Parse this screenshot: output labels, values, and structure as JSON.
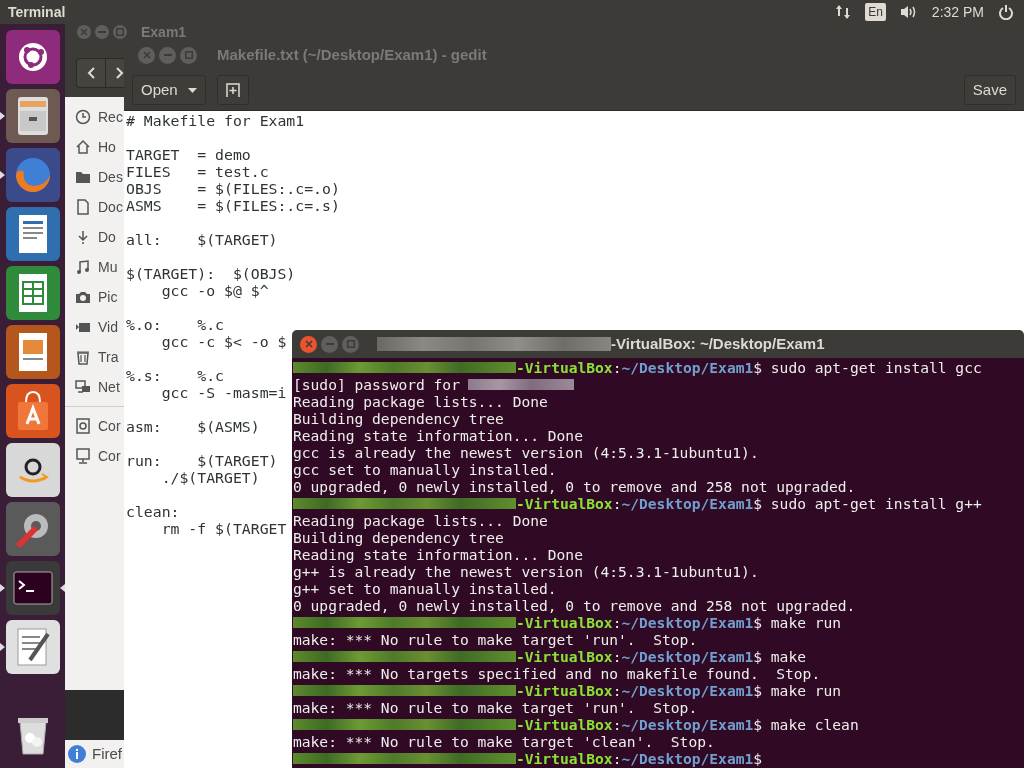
{
  "top_bar": {
    "app_title": "Terminal",
    "keyboard_layout": "En",
    "clock": "2:32 PM"
  },
  "launcher": [
    {
      "kind": "dash",
      "running": false,
      "focused": false
    },
    {
      "kind": "files",
      "running": true,
      "focused": false
    },
    {
      "kind": "browser",
      "running": true,
      "focused": false
    },
    {
      "kind": "writer",
      "running": false,
      "focused": false
    },
    {
      "kind": "calc",
      "running": false,
      "focused": false
    },
    {
      "kind": "impress",
      "running": false,
      "focused": false
    },
    {
      "kind": "store",
      "running": false,
      "focused": false
    },
    {
      "kind": "shop",
      "running": false,
      "focused": false
    },
    {
      "kind": "settings",
      "running": false,
      "focused": false
    },
    {
      "kind": "terminal",
      "running": true,
      "focused": true
    },
    {
      "kind": "editor",
      "running": true,
      "focused": false
    },
    {
      "kind": "trash",
      "running": false,
      "focused": false
    }
  ],
  "files_window": {
    "title": "Exam1",
    "sidebar": [
      {
        "kind": "clock",
        "label": "Rec"
      },
      {
        "kind": "home",
        "label": "Ho"
      },
      {
        "kind": "folder",
        "label": "Des"
      },
      {
        "kind": "document",
        "label": "Doc"
      },
      {
        "kind": "download",
        "label": "Do"
      },
      {
        "kind": "music",
        "label": "Mu"
      },
      {
        "kind": "camera",
        "label": "Pic"
      },
      {
        "kind": "video",
        "label": "Vid"
      },
      {
        "kind": "trash",
        "label": "Tra"
      },
      {
        "kind": "network",
        "label": "Net"
      },
      {
        "kind": "server",
        "label": "Cor",
        "separator_before": true
      },
      {
        "kind": "computer",
        "label": "Cor"
      }
    ],
    "status": "Firef"
  },
  "gedit": {
    "title": "Makefile.txt (~/Desktop/Exam1) - gedit",
    "open_button": "Open",
    "save_button": "Save",
    "lines": [
      {
        "kind": "code",
        "text": "# Makefile for Exam1"
      },
      {
        "kind": "blank"
      },
      {
        "kind": "code",
        "text": "TARGET  = demo"
      },
      {
        "kind": "code",
        "text": "FILES   = test.c"
      },
      {
        "kind": "code",
        "text": "OBJS    = $(FILES:.c=.o)"
      },
      {
        "kind": "code",
        "text": "ASMS    = $(FILES:.c=.s)"
      },
      {
        "kind": "blank"
      },
      {
        "kind": "code",
        "text": "all:    $(TARGET)"
      },
      {
        "kind": "blank"
      },
      {
        "kind": "code",
        "text": "$(TARGET):  $(OBJS)"
      },
      {
        "kind": "code",
        "text": "    gcc -o $@ $^"
      },
      {
        "kind": "blank"
      },
      {
        "kind": "code",
        "text": "%.o:    %.c"
      },
      {
        "kind": "code",
        "text": "    gcc -c $< -o $"
      },
      {
        "kind": "blank"
      },
      {
        "kind": "code",
        "text": "%.s:    %.c"
      },
      {
        "kind": "code",
        "text": "    gcc -S -masm=i"
      },
      {
        "kind": "blank"
      },
      {
        "kind": "code",
        "text": "asm:    $(ASMS)"
      },
      {
        "kind": "blank"
      },
      {
        "kind": "code",
        "text": "run:    $(TARGET)"
      },
      {
        "kind": "code",
        "text": "    ./$(TARGET)"
      },
      {
        "kind": "blank"
      },
      {
        "kind": "code",
        "text": "clean:"
      },
      {
        "kind": "code",
        "text": "    rm -f $(TARGET"
      }
    ]
  },
  "terminal": {
    "title": "-VirtualBox: ~/Desktop/Exam1",
    "lines": [
      {
        "kind": "prompt",
        "host": "-VirtualBox",
        "colon": ":",
        "path": "~/Desktop/Exam1",
        "sign": "$",
        "command": "sudo apt-get install gcc"
      },
      {
        "kind": "password",
        "text": "[sudo] password for"
      },
      {
        "kind": "output",
        "text": "Reading package lists... Done"
      },
      {
        "kind": "output",
        "text": "Building dependency tree"
      },
      {
        "kind": "output",
        "text": "Reading state information... Done"
      },
      {
        "kind": "output",
        "text": "gcc is already the newest version (4:5.3.1-1ubuntu1)."
      },
      {
        "kind": "output",
        "text": "gcc set to manually installed."
      },
      {
        "kind": "output",
        "text": "0 upgraded, 0 newly installed, 0 to remove and 258 not upgraded."
      },
      {
        "kind": "prompt",
        "host": "-VirtualBox",
        "colon": ":",
        "path": "~/Desktop/Exam1",
        "sign": "$",
        "command": "sudo apt-get install g++"
      },
      {
        "kind": "output",
        "text": "Reading package lists... Done"
      },
      {
        "kind": "output",
        "text": "Building dependency tree"
      },
      {
        "kind": "output",
        "text": "Reading state information... Done"
      },
      {
        "kind": "output",
        "text": "g++ is already the newest version (4:5.3.1-1ubuntu1)."
      },
      {
        "kind": "output",
        "text": "g++ set to manually installed."
      },
      {
        "kind": "output",
        "text": "0 upgraded, 0 newly installed, 0 to remove and 258 not upgraded."
      },
      {
        "kind": "prompt",
        "host": "-VirtualBox",
        "colon": ":",
        "path": "~/Desktop/Exam1",
        "sign": "$",
        "command": "make run"
      },
      {
        "kind": "output",
        "text": "make: *** No rule to make target 'run'.  Stop."
      },
      {
        "kind": "prompt",
        "host": "-VirtualBox",
        "colon": ":",
        "path": "~/Desktop/Exam1",
        "sign": "$",
        "command": "make"
      },
      {
        "kind": "output",
        "text": "make: *** No targets specified and no makefile found.  Stop."
      },
      {
        "kind": "prompt",
        "host": "-VirtualBox",
        "colon": ":",
        "path": "~/Desktop/Exam1",
        "sign": "$",
        "command": "make run"
      },
      {
        "kind": "output",
        "text": "make: *** No rule to make target 'run'.  Stop."
      },
      {
        "kind": "prompt",
        "host": "-VirtualBox",
        "colon": ":",
        "path": "~/Desktop/Exam1",
        "sign": "$",
        "command": "make clean"
      },
      {
        "kind": "output",
        "text": "make: *** No rule to make target 'clean'.  Stop."
      },
      {
        "kind": "prompt",
        "host": "-VirtualBox",
        "colon": ":",
        "path": "~/Desktop/Exam1",
        "sign": "$"
      }
    ]
  }
}
